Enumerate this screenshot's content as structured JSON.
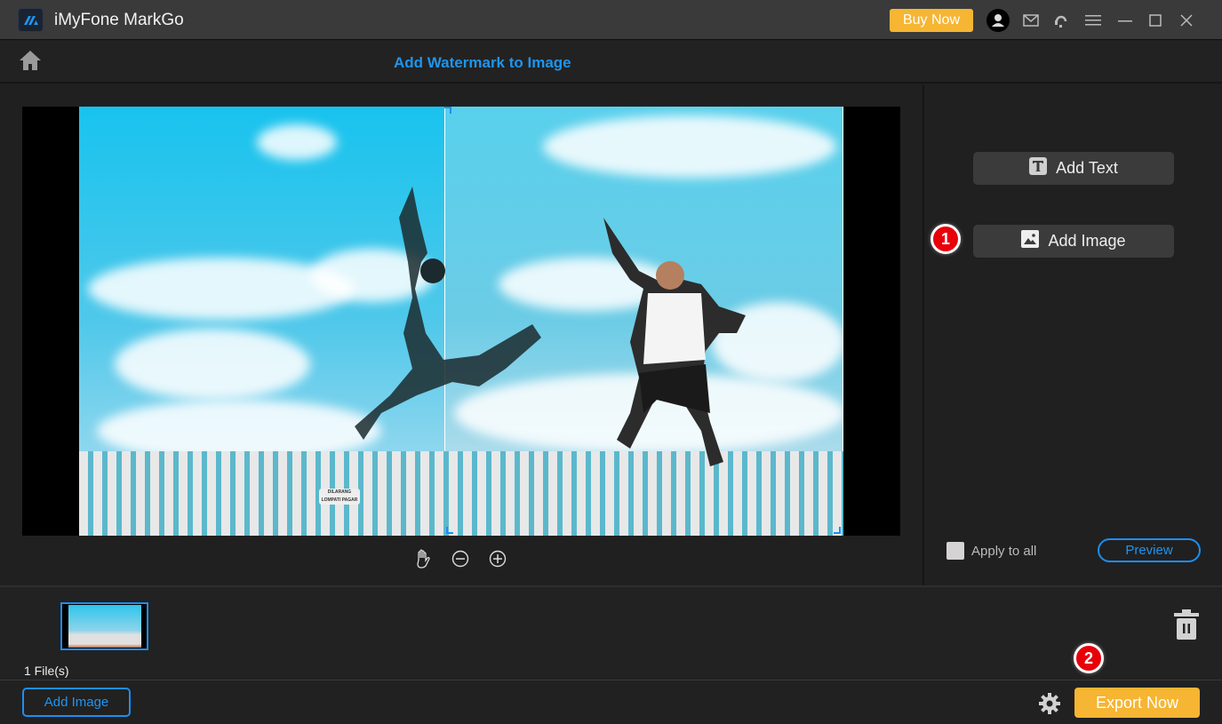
{
  "app": {
    "title": "iMyFone MarkGo",
    "buy_now_label": "Buy Now",
    "icons": [
      "app-logo-icon",
      "account-icon",
      "mail-icon",
      "support-icon",
      "menu-icon",
      "minimize-icon",
      "maximize-icon",
      "close-icon"
    ]
  },
  "header": {
    "page_title": "Add Watermark to Image",
    "home_icon": "home-icon"
  },
  "canvas": {
    "sign_text_line1": "DILARANG",
    "sign_text_line2": "LOMPATI PAGAR",
    "remove_label": "×",
    "zoom_tools": [
      "hand-icon",
      "zoom-out-icon",
      "zoom-in-icon"
    ]
  },
  "side_panel": {
    "add_text_label": "Add Text",
    "add_image_label": "Add Image",
    "step1_label": "1",
    "apply_to_all_label": "Apply to all",
    "apply_to_all_checked": false,
    "preview_label": "Preview"
  },
  "file_strip": {
    "file_count": "1 File(s)",
    "step2_label": "2"
  },
  "bottom_bar": {
    "add_image_label": "Add Image",
    "export_label": "Export Now"
  },
  "colors": {
    "accent_blue": "#1e95f0",
    "accent_orange": "#f6b532",
    "step_red": "#e8000b"
  }
}
